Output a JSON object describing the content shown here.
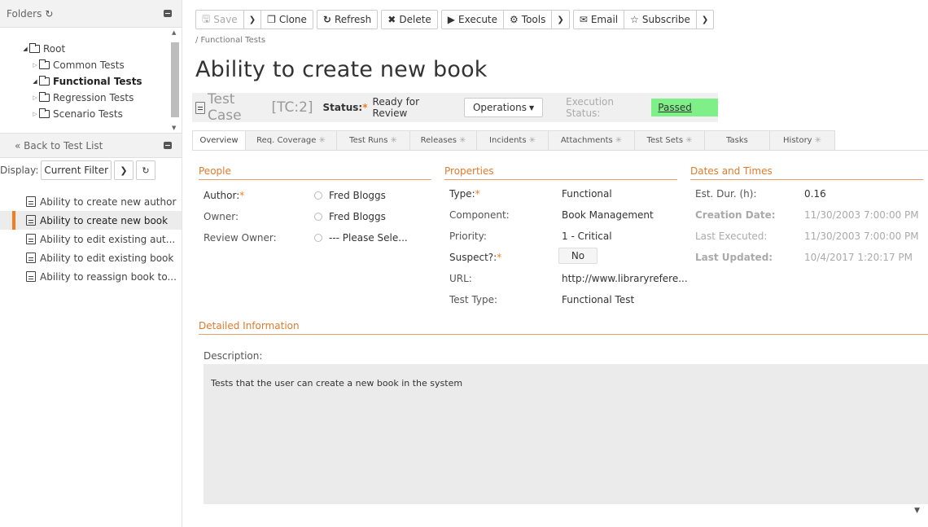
{
  "folders": {
    "title": "Folders",
    "tree": [
      {
        "label": "Root",
        "state": "open",
        "level": 0
      },
      {
        "label": "Common Tests",
        "state": "closed",
        "level": 1
      },
      {
        "label": "Functional Tests",
        "state": "open",
        "level": 1,
        "selected": true
      },
      {
        "label": "Regression Tests",
        "state": "closed",
        "level": 1
      },
      {
        "label": "Scenario Tests",
        "state": "closed",
        "level": 1
      }
    ]
  },
  "list": {
    "back_label": "« Back to Test List",
    "display_label": "Display:",
    "filter_value": "Current Filter",
    "items": [
      {
        "label": "Ability to create new author"
      },
      {
        "label": "Ability to create new book",
        "active": true
      },
      {
        "label": "Ability to edit existing aut..."
      },
      {
        "label": "Ability to edit existing book"
      },
      {
        "label": "Ability to reassign book to..."
      }
    ]
  },
  "toolbar": {
    "save": "Save",
    "clone": "Clone",
    "refresh": "Refresh",
    "delete": "Delete",
    "execute": "Execute",
    "tools": "Tools",
    "email": "Email",
    "subscribe": "Subscribe"
  },
  "breadcrumb": "/ Functional Tests",
  "page_title": "Ability to create new book",
  "infobar": {
    "test_case_label": "Test Case",
    "test_case_id": "[TC:2]",
    "status_label": "Status:",
    "status_value": "Ready for Review",
    "operations": "Operations",
    "execution_status_label": "Execution Status:",
    "execution_status_value": "Passed",
    "execution_status_color": "#7ef087"
  },
  "tabs": [
    {
      "label": "Overview",
      "active": true,
      "gear": false
    },
    {
      "label": "Req. Coverage",
      "gear": true
    },
    {
      "label": "Test Runs",
      "gear": true
    },
    {
      "label": "Releases",
      "gear": true
    },
    {
      "label": "Incidents",
      "gear": true
    },
    {
      "label": "Attachments",
      "gear": true
    },
    {
      "label": "Test Sets",
      "gear": true
    },
    {
      "label": "Tasks",
      "gear": false
    },
    {
      "label": "History",
      "gear": true
    }
  ],
  "people": {
    "heading": "People",
    "author_label": "Author:",
    "author_value": "Fred Bloggs",
    "owner_label": "Owner:",
    "owner_value": "Fred Bloggs",
    "review_owner_label": "Review Owner:",
    "review_owner_value": "--- Please Sele..."
  },
  "properties": {
    "heading": "Properties",
    "type_label": "Type:",
    "type_value": "Functional",
    "component_label": "Component:",
    "component_value": "Book Management",
    "priority_label": "Priority:",
    "priority_value": "1 - Critical",
    "suspect_label": "Suspect?:",
    "suspect_value": "No",
    "url_label": "URL:",
    "url_value": "http://www.libraryrefere...",
    "test_type_label": "Test Type:",
    "test_type_value": "Functional Test"
  },
  "dates": {
    "heading": "Dates and Times",
    "est_dur_label": "Est. Dur. (h):",
    "est_dur_value": "0.16",
    "creation_label": "Creation Date:",
    "creation_value": "11/30/2003 7:00:00 PM",
    "last_exec_label": "Last Executed:",
    "last_exec_value": "11/30/2003 7:00:00 PM",
    "last_upd_label": "Last Updated:",
    "last_upd_value": "10/4/2017 1:20:17 PM"
  },
  "detailed": {
    "heading": "Detailed Information",
    "description_label": "Description:",
    "description_value": "Tests that the user can create a new book in the system"
  },
  "colors": {
    "accent": "#f47d20",
    "section": "#e07a2a",
    "passed": "#7ef087"
  }
}
